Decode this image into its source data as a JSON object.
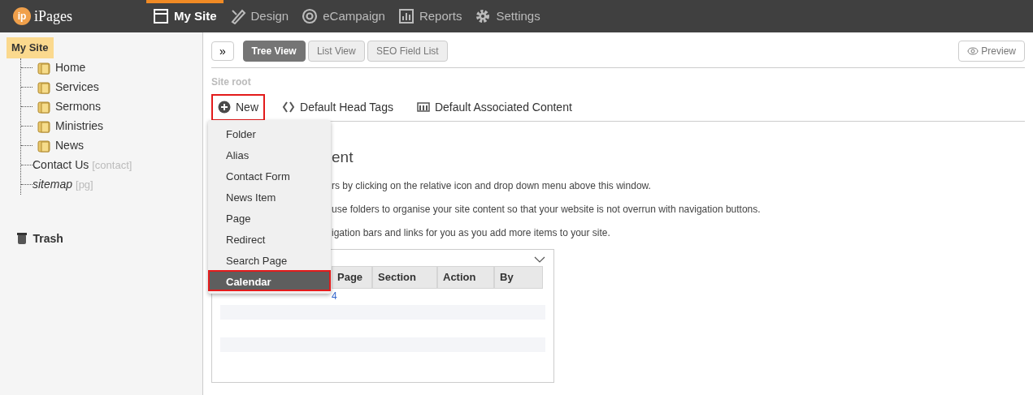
{
  "topbar": {
    "logo_mark": "ip",
    "logo_text": "iPages",
    "nav": [
      {
        "label": "My Site",
        "selected": true
      },
      {
        "label": "Design",
        "selected": false
      },
      {
        "label": "eCampaign",
        "selected": false
      },
      {
        "label": "Reports",
        "selected": false
      },
      {
        "label": "Settings",
        "selected": false
      }
    ]
  },
  "sidebar": {
    "root": {
      "label": "My Site",
      "selected": true
    },
    "items": [
      {
        "label": "Home",
        "kind": "folder"
      },
      {
        "label": "Services",
        "kind": "folder"
      },
      {
        "label": "Sermons",
        "kind": "folder"
      },
      {
        "label": "Ministries",
        "kind": "folder"
      },
      {
        "label": "News",
        "kind": "folder"
      },
      {
        "label": "Contact Us",
        "kind": "page",
        "tag": "[contact]",
        "italic": false
      },
      {
        "label": "sitemap",
        "kind": "page",
        "tag": "[pg]",
        "italic": true
      }
    ],
    "trash": "Trash"
  },
  "toolbar": {
    "expand": "»",
    "views": [
      {
        "label": "Tree View",
        "selected": true
      },
      {
        "label": "List View",
        "selected": false
      },
      {
        "label": "SEO Field List",
        "selected": false
      }
    ],
    "preview": "Preview"
  },
  "breadcrumb": "Site root",
  "actions": [
    {
      "label": "New",
      "highlighted": true
    },
    {
      "label": "Default Head Tags",
      "highlighted": false
    },
    {
      "label": "Default Associated Content",
      "highlighted": false
    }
  ],
  "new_menu": [
    {
      "label": "Folder",
      "selected": false
    },
    {
      "label": "Alias",
      "selected": false
    },
    {
      "label": "Contact Form",
      "selected": false
    },
    {
      "label": "News Item",
      "selected": false
    },
    {
      "label": "Page",
      "selected": false
    },
    {
      "label": "Redirect",
      "selected": false
    },
    {
      "label": "Search Page",
      "selected": false
    },
    {
      "label": "Calendar",
      "selected": true
    }
  ],
  "content": {
    "heading": "ent",
    "paragraphs": [
      "rs by clicking on the relative icon and drop down menu above this window.",
      "use folders to organise your site content so that your website is not overrun with navigation buttons.",
      "igation bars and links for you as you add more items to your site."
    ],
    "table": {
      "columns": [
        "Page",
        "Section",
        "Action",
        "By"
      ],
      "first_cell": "4"
    }
  }
}
